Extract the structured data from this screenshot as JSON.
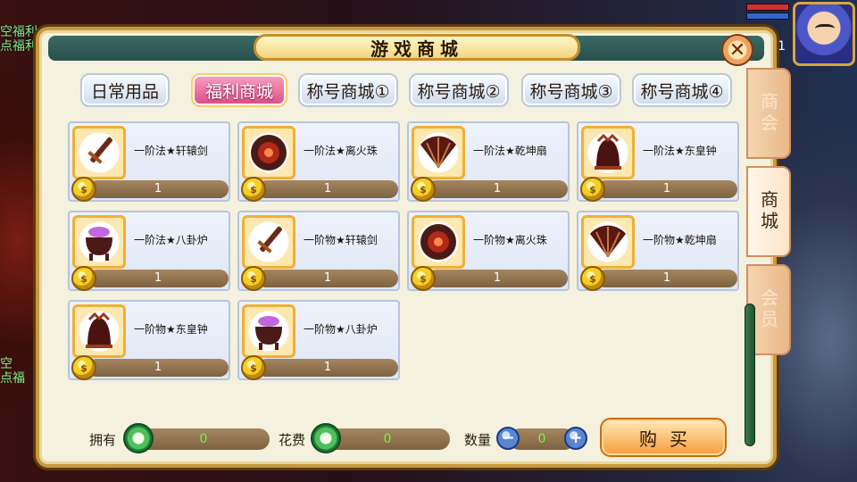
{
  "background": {
    "left_texts": [
      "空福利",
      "点福利"
    ],
    "left_texts_lower": [
      "空",
      "点福"
    ],
    "hud_number": "1"
  },
  "window": {
    "title": "游戏商城",
    "close_label": "✕"
  },
  "tabs": [
    {
      "label": "日常用品",
      "active": false
    },
    {
      "label": "福利商城",
      "active": true
    },
    {
      "label": "称号商城①",
      "active": false
    },
    {
      "label": "称号商城②",
      "active": false
    },
    {
      "label": "称号商城③",
      "active": false
    },
    {
      "label": "称号商城④",
      "active": false
    }
  ],
  "items": [
    {
      "name": "一阶法★轩辕剑",
      "price": "1",
      "icon": "sword-icon"
    },
    {
      "name": "一阶法★离火珠",
      "price": "1",
      "icon": "fire-orb-icon"
    },
    {
      "name": "一阶法★乾坤扇",
      "price": "1",
      "icon": "fan-icon"
    },
    {
      "name": "一阶法★东皇钟",
      "price": "1",
      "icon": "bell-icon"
    },
    {
      "name": "一阶法★八卦炉",
      "price": "1",
      "icon": "cauldron-icon"
    },
    {
      "name": "一阶物★轩辕剑",
      "price": "1",
      "icon": "sword-icon"
    },
    {
      "name": "一阶物★离火珠",
      "price": "1",
      "icon": "fire-orb-icon"
    },
    {
      "name": "一阶物★乾坤扇",
      "price": "1",
      "icon": "fan-icon"
    },
    {
      "name": "一阶物★东皇钟",
      "price": "1",
      "icon": "bell-icon"
    },
    {
      "name": "一阶物★八卦炉",
      "price": "1",
      "icon": "cauldron-icon"
    }
  ],
  "footer": {
    "own_label": "拥有",
    "own_value": "0",
    "cost_label": "花费",
    "cost_value": "0",
    "qty_label": "数量",
    "qty_value": "0",
    "minus_label": "−",
    "plus_label": "+",
    "buy_label": "购买"
  },
  "side_tabs": [
    {
      "label": "商会",
      "active": false
    },
    {
      "label": "商城",
      "active": true
    },
    {
      "label": "会员",
      "active": false
    }
  ],
  "colors": {
    "accent_active_tab": "#dc4c86",
    "price_bar": "#7e6240",
    "value_green": "#7af04a",
    "frame_gold": "#c69a3c"
  }
}
